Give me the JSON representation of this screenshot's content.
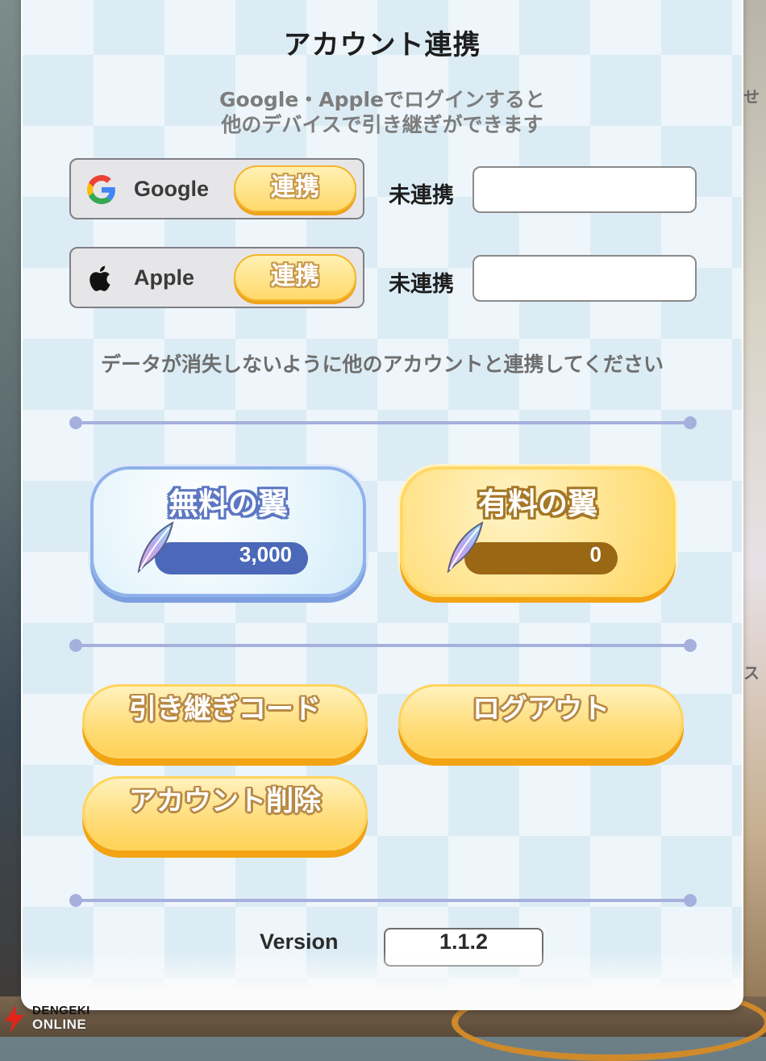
{
  "dialog": {
    "title": "アカウント連携",
    "subtitle_line1": "Google・Appleでログインすると",
    "subtitle_line2": "他のデバイスで引き継ぎができます"
  },
  "accounts": [
    {
      "service": "Google",
      "icon": "google-icon",
      "link_label": "連携",
      "status": "未連携",
      "id_value": ""
    },
    {
      "service": "Apple",
      "icon": "apple-icon",
      "link_label": "連携",
      "status": "未連携",
      "id_value": ""
    }
  ],
  "notice": "データが消失しないように他のアカウントと連携してください",
  "wings": {
    "free": {
      "label": "無料の翼",
      "amount": "3,000",
      "icon": "wing-feather-icon"
    },
    "paid": {
      "label": "有料の翼",
      "amount": "0",
      "icon": "wing-feather-icon"
    }
  },
  "actions": {
    "transfer_code": "引き継ぎコード",
    "logout": "ログアウト",
    "delete_account": "アカウント削除"
  },
  "version": {
    "label": "Version",
    "value": "1.1.2"
  },
  "background_peek": {
    "text_top": "せ",
    "text_mid": "ス"
  },
  "watermark": {
    "line1": "DENGEKI",
    "line2": "ONLINE"
  },
  "colors": {
    "button_yellow": "#ffd96a",
    "button_shadow": "#f2a414",
    "free_accent": "#4b69b8",
    "paid_accent": "#9a6715",
    "divider": "#a6b0dd"
  }
}
